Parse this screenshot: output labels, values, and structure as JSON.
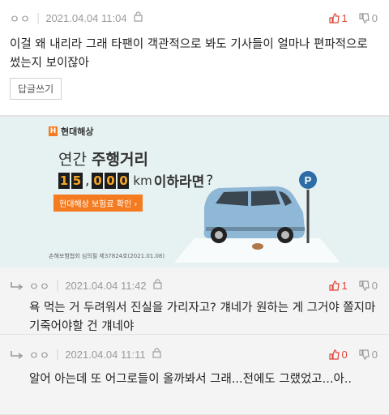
{
  "comments": [
    {
      "user": "ㅇㅇ",
      "time": "2021.04.04 11:04",
      "up": "1",
      "down": "0",
      "text": "이걸 왜 내리라 그래 타팬이 객관적으로 봐도 기사들이 얼마나 편파적으로 썼는지 보이잖아",
      "reply_label": "답글쓰기"
    }
  ],
  "ad": {
    "brand": "현대해상",
    "headline_prefix": "연간 ",
    "headline_bold": "주행거리",
    "digits": [
      "1",
      "5",
      "0",
      "0",
      "0"
    ],
    "unit": "km",
    "suffix_bold": " 이하라면",
    "suffix_q": "?",
    "cta": "현대해상 보험료 확인 ›",
    "footer": "손해보험협회 심의필 제37824호(2021.01.08)",
    "colors": {
      "brand": "#f47b20",
      "car": "#8fb7d6",
      "parking": "#2e6ca8"
    }
  },
  "replies": [
    {
      "user": "ㅇㅇ",
      "time": "2021.04.04 11:42",
      "up": "1",
      "down": "0",
      "text": "욕 먹는 거 두려워서 진실을 가리자고? 걔네가 원하는 게 그거야 쫄지마 기죽어야할 건 걔네야"
    },
    {
      "user": "ㅇㅇ",
      "time": "2021.04.04 11:11",
      "up": "0",
      "down": "0",
      "text": "알어 아는데 또 어그로들이 올까봐서 그래...전에도 그랬었고...아.."
    }
  ]
}
